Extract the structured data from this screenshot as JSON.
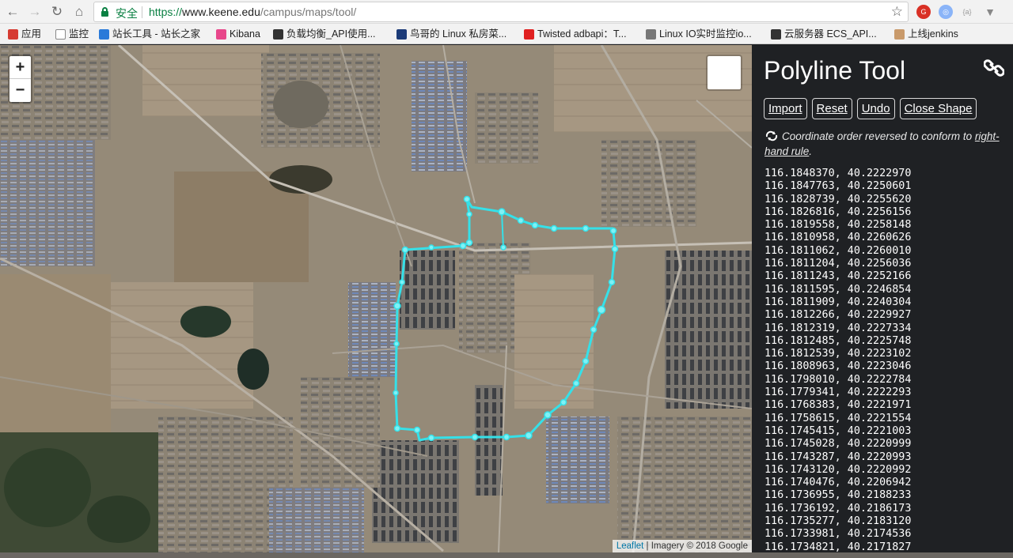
{
  "browser": {
    "secure_label": "安全",
    "url_scheme": "https://",
    "url_host": "www.keene.edu",
    "url_path": "/campus/maps/tool/",
    "icons": [
      "back-icon",
      "forward-icon",
      "reload-icon",
      "home-icon",
      "star-icon"
    ]
  },
  "bookmarks": [
    {
      "label": "应用",
      "icon": "apps-grid-icon",
      "color": "#d63b32"
    },
    {
      "label": "监控",
      "icon": "page-icon",
      "color": "#ffffff"
    },
    {
      "label": "站长工具 - 站长之家",
      "icon": "chinaz-icon",
      "color": "#2a7ad9"
    },
    {
      "label": "Kibana",
      "icon": "kibana-icon",
      "color": "#e8478b"
    },
    {
      "label": "负载均衡_API使用...",
      "icon": "aliyun-icon",
      "color": "#333333"
    },
    {
      "label": "鸟哥的 Linux 私房菜...",
      "icon": "vbird-icon",
      "color": "#1c3b78"
    },
    {
      "label": "Twisted adbapi：T...",
      "icon": "twisted-icon",
      "color": "#e02020"
    },
    {
      "label": "Linux IO实时监控io...",
      "icon": "blog-icon",
      "color": "#777777"
    },
    {
      "label": "云服务器 ECS_API...",
      "icon": "aliyun-icon",
      "color": "#333333"
    },
    {
      "label": "上线jenkins",
      "icon": "jenkins-icon",
      "color": "#c99a6b"
    }
  ],
  "map": {
    "zoom_in": "+",
    "zoom_out": "−",
    "attribution_link": "Leaflet",
    "attribution_text": " | Imagery © 2018 Google",
    "route_color": "#35e0e8"
  },
  "panel": {
    "title": "Polyline Tool",
    "buttons": [
      "Import",
      "Reset",
      "Undo",
      "Close Shape"
    ],
    "note_main": "Coordinate order reversed to conform to ",
    "note_link": "right-hand rule",
    "note_end": ".",
    "coordinates": [
      "116.1848370, 40.2222970",
      "116.1847763, 40.2250601",
      "116.1828739, 40.2255620",
      "116.1826816, 40.2256156",
      "116.1819558, 40.2258148",
      "116.1810958, 40.2260626",
      "116.1811062, 40.2260010",
      "116.1811204, 40.2256036",
      "116.1811243, 40.2252166",
      "116.1811595, 40.2246854",
      "116.1811909, 40.2240304",
      "116.1812266, 40.2229927",
      "116.1812319, 40.2227334",
      "116.1812485, 40.2225748",
      "116.1812539, 40.2223102",
      "116.1808963, 40.2223046",
      "116.1798010, 40.2222784",
      "116.1779341, 40.2222293",
      "116.1768383, 40.2221971",
      "116.1758615, 40.2221554",
      "116.1745415, 40.2221003",
      "116.1745028, 40.2220999",
      "116.1743287, 40.2220993",
      "116.1743120, 40.2220992",
      "116.1740476, 40.2206942",
      "116.1736955, 40.2188233",
      "116.1736192, 40.2186173",
      "116.1735277, 40.2183120",
      "116.1733981, 40.2174536",
      "116.1734821, 40.2171827"
    ]
  }
}
